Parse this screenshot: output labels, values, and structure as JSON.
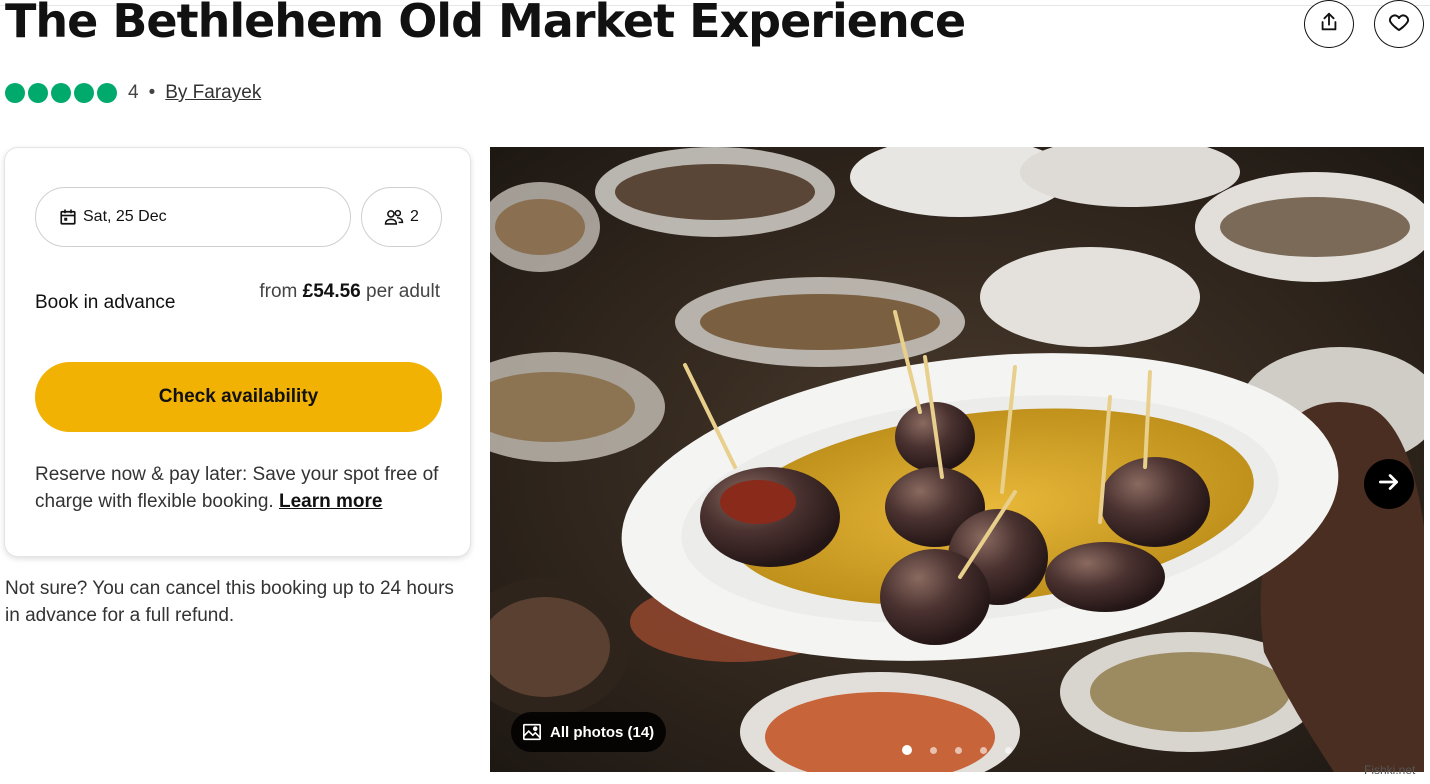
{
  "page": {
    "title": "The Bethlehem Old Market Experience"
  },
  "header_actions": {
    "share_icon": "share-icon",
    "favorite_icon": "heart-icon"
  },
  "rating": {
    "bubbles": 5,
    "count": "4",
    "separator": "•",
    "author": "By Farayek",
    "color": "#00aa6c"
  },
  "booking": {
    "date_label": "Sat, 25 Dec",
    "date_icon": "calendar-icon",
    "guests_label": "2",
    "guests_icon": "people-icon",
    "book_label": "Book in advance",
    "price_prefix": "from",
    "price_value": "£54.56",
    "price_suffix": "per adult",
    "cta_label": "Check availability",
    "cta_color": "#f2b203",
    "reserve_text": "Reserve now & pay later: Save your spot free of charge with flexible booking.",
    "learn_more": "Learn more"
  },
  "cancel_note": "Not sure? You can cancel this booking up to 24 hours in advance for a full refund.",
  "gallery": {
    "all_photos_label": "All photos (14)",
    "photo_icon": "image-icon",
    "next_icon": "arrow-right-icon",
    "dot_count": 5,
    "active_dot": 1
  },
  "watermark": "Fishki.net"
}
